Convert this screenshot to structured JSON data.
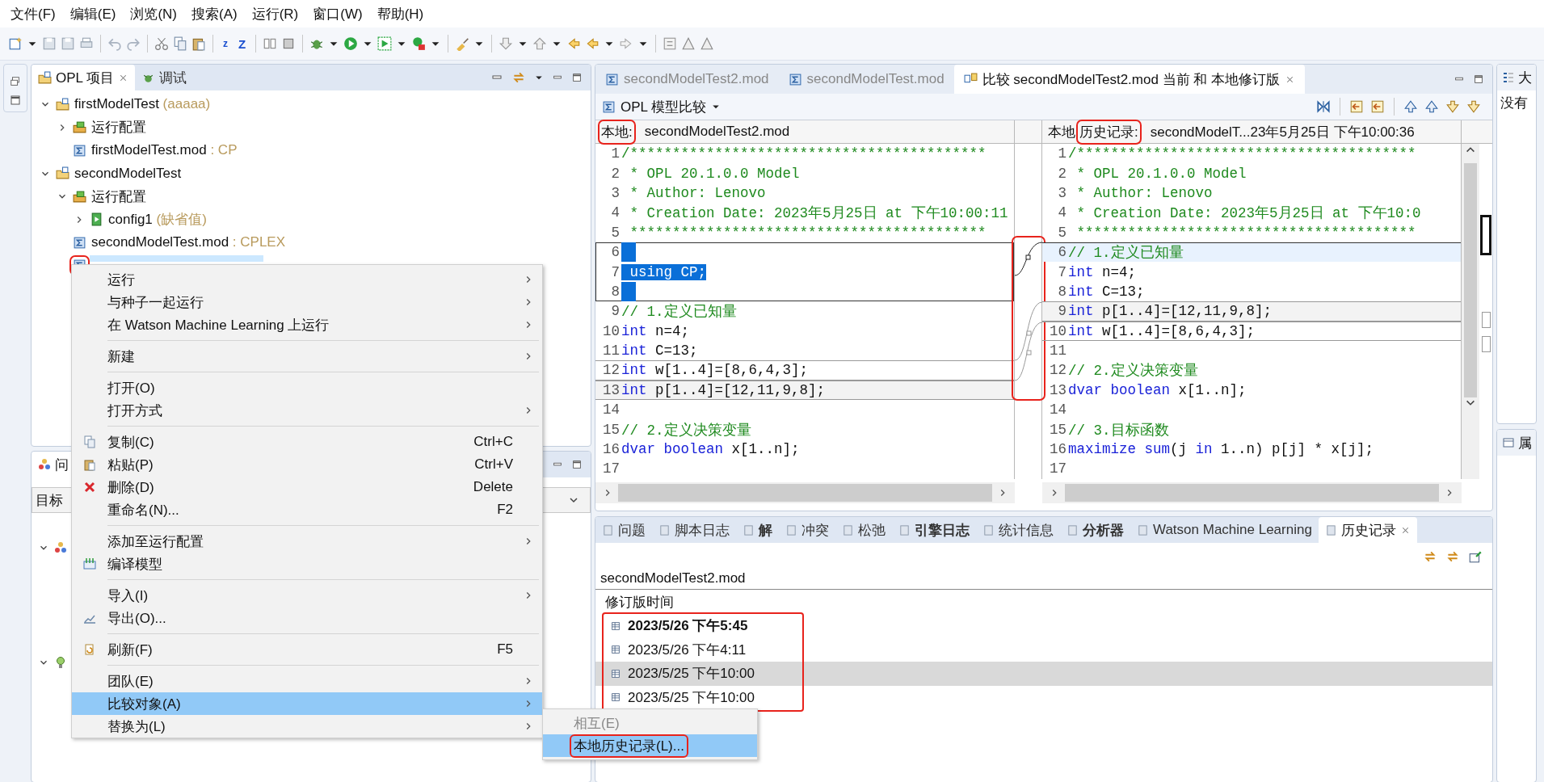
{
  "menu_bar": [
    "文件(F)",
    "编辑(E)",
    "浏览(N)",
    "搜索(A)",
    "运行(R)",
    "窗口(W)",
    "帮助(H)"
  ],
  "toolbar": {
    "letters": [
      "z",
      "Z"
    ]
  },
  "project_view": {
    "tabs": [
      {
        "label": "OPL 项目",
        "selected": true
      },
      {
        "label": "调试",
        "selected": false
      }
    ],
    "tree": [
      {
        "label": "firstModelTest",
        "suffix": "(aaaaa)",
        "kind": "project",
        "expanded": true,
        "selected": false,
        "children": [
          {
            "label": "运行配置",
            "kind": "runconfig",
            "expanded": false,
            "selected": false
          },
          {
            "label": "firstModelTest.mod",
            "suffix": ": CP",
            "kind": "model",
            "selected": false
          }
        ]
      },
      {
        "label": "secondModelTest",
        "kind": "project",
        "expanded": true,
        "selected": false,
        "children": [
          {
            "label": "运行配置",
            "kind": "runconfig",
            "expanded": true,
            "selected": false,
            "children": [
              {
                "label": "config1",
                "suffix": "(缺省值)",
                "kind": "config",
                "expanded": false,
                "selected": false
              }
            ]
          },
          {
            "label": "secondModelTest.mod",
            "suffix": ": CPLEX",
            "kind": "model",
            "selected": false
          },
          {
            "kind": "model",
            "selected": true,
            "highlighted": true
          }
        ]
      }
    ]
  },
  "problems_view": {
    "tab": "问",
    "filter": "目标",
    "groups": [
      {
        "kind": "targets",
        "expanded": true
      },
      {
        "kind": "hint",
        "expanded": true
      }
    ]
  },
  "context_menu": {
    "items": [
      {
        "kind": "item",
        "label": "运行",
        "submenu": true,
        "selected": false
      },
      {
        "kind": "item",
        "label": "与种子一起运行",
        "submenu": true,
        "selected": false
      },
      {
        "kind": "item",
        "label": "在 Watson Machine Learning 上运行",
        "submenu": true,
        "selected": false
      },
      {
        "kind": "separator"
      },
      {
        "kind": "item",
        "label": "新建",
        "submenu": true,
        "selected": false
      },
      {
        "kind": "separator"
      },
      {
        "kind": "item",
        "label": "打开(O)",
        "submenu": false,
        "selected": false
      },
      {
        "kind": "item",
        "label": "打开方式",
        "submenu": true,
        "selected": false
      },
      {
        "kind": "separator"
      },
      {
        "kind": "item",
        "label": "复制(C)",
        "shortcut": "Ctrl+C",
        "submenu": false,
        "selected": false
      },
      {
        "kind": "item",
        "label": "粘贴(P)",
        "shortcut": "Ctrl+V",
        "submenu": false,
        "selected": false
      },
      {
        "kind": "item",
        "label": "删除(D)",
        "shortcut": "Delete",
        "submenu": false,
        "selected": false
      },
      {
        "kind": "item",
        "label": "重命名(N)...",
        "shortcut": "F2",
        "submenu": false,
        "selected": false
      },
      {
        "kind": "separator"
      },
      {
        "kind": "item",
        "label": "添加至运行配置",
        "submenu": true,
        "selected": false
      },
      {
        "kind": "item",
        "label": "编译模型",
        "submenu": false,
        "selected": false
      },
      {
        "kind": "separator"
      },
      {
        "kind": "item",
        "label": "导入(I)",
        "submenu": true,
        "selected": false
      },
      {
        "kind": "item",
        "label": "导出(O)...",
        "submenu": false,
        "selected": false
      },
      {
        "kind": "separator"
      },
      {
        "kind": "item",
        "label": "刷新(F)",
        "shortcut": "F5",
        "submenu": false,
        "selected": false
      },
      {
        "kind": "separator"
      },
      {
        "kind": "item",
        "label": "团队(E)",
        "submenu": true,
        "selected": false
      },
      {
        "kind": "item",
        "label": "比较对象(A)",
        "submenu": true,
        "selected": true
      },
      {
        "kind": "item",
        "label": "替换为(L)",
        "submenu": true,
        "selected": false
      }
    ],
    "submenu": [
      {
        "label": "相互(E)",
        "disabled": true,
        "selected": false,
        "highlighted": false
      },
      {
        "label": "本地历史记录(L)...",
        "disabled": false,
        "selected": true,
        "highlighted": true
      }
    ]
  },
  "editor": {
    "tabs": [
      {
        "label": "secondModelTest2.mod",
        "kind": "model",
        "selected": false
      },
      {
        "label": "secondModelTest.mod",
        "kind": "model",
        "selected": false
      },
      {
        "label": "比较 secondModelTest2.mod 当前 和 本地修订版",
        "kind": "compare",
        "selected": true
      }
    ],
    "compare": {
      "title": "OPL 模型比较",
      "left_header": {
        "parts": [
          {
            "text": "本地:",
            "highlighted": true
          }
        ],
        "file": "secondModelTest2.mod"
      },
      "right_header": {
        "parts": [
          {
            "text": "本地",
            "highlighted": false
          },
          {
            "text": "历史记录:",
            "highlighted": true
          }
        ],
        "file": "secondModelT...23年5月25日 下午10:00:36"
      },
      "gutter_highlighted": true,
      "left_lines": [
        {
          "n": "1",
          "kind": "plain",
          "tokens": [
            {
              "kind": "comment",
              "text": "/******************************************"
            }
          ]
        },
        {
          "n": "2",
          "kind": "plain",
          "tokens": [
            {
              "kind": "comment",
              "text": " * OPL 20.1.0.0 Model"
            }
          ]
        },
        {
          "n": "3",
          "kind": "plain",
          "tokens": [
            {
              "kind": "comment",
              "text": " * Author: Lenovo"
            }
          ]
        },
        {
          "n": "4",
          "kind": "plain",
          "tokens": [
            {
              "kind": "comment",
              "text": " * Creation Date: 2023年5月25日 at 下午10:00:11"
            }
          ]
        },
        {
          "n": "5",
          "kind": "plain",
          "tokens": [
            {
              "kind": "comment",
              "text": " ******************************************"
            }
          ]
        },
        {
          "n": "6",
          "kind": "selected"
        },
        {
          "n": "7",
          "kind": "selected",
          "tokens": [
            {
              "kind": "plain",
              "text": " using CP;"
            }
          ]
        },
        {
          "n": "8",
          "kind": "selected"
        },
        {
          "n": "9",
          "kind": "plain",
          "tokens": [
            {
              "kind": "comment",
              "text": "// 1.定义已知量"
            }
          ]
        },
        {
          "n": "10",
          "kind": "plain",
          "tokens": [
            {
              "kind": "keyword",
              "text": "int"
            },
            {
              "kind": "plain",
              "text": " n=4;"
            }
          ]
        },
        {
          "n": "11",
          "kind": "plain",
          "tokens": [
            {
              "kind": "keyword",
              "text": "int"
            },
            {
              "kind": "plain",
              "text": " C=13;"
            }
          ]
        },
        {
          "n": "12",
          "kind": "changed",
          "tokens": [
            {
              "kind": "keyword",
              "text": "int"
            },
            {
              "kind": "plain",
              "text": " w[1..4]=[8,6,4,3];"
            }
          ]
        },
        {
          "n": "13",
          "kind": "shaded",
          "tokens": [
            {
              "kind": "keyword",
              "text": "int"
            },
            {
              "kind": "plain",
              "text": " p[1..4]=[12,11,9,8];"
            }
          ]
        },
        {
          "n": "14",
          "kind": "plain"
        },
        {
          "n": "15",
          "kind": "plain",
          "tokens": [
            {
              "kind": "comment",
              "text": "// 2.定义决策变量"
            }
          ]
        },
        {
          "n": "16",
          "kind": "plain",
          "tokens": [
            {
              "kind": "keyword",
              "text": "dvar boolean"
            },
            {
              "kind": "plain",
              "text": " x[1..n];"
            }
          ]
        },
        {
          "n": "17",
          "kind": "plain"
        }
      ],
      "right_lines": [
        {
          "n": "1",
          "kind": "plain",
          "tokens": [
            {
              "kind": "comment",
              "text": "/****************************************"
            }
          ]
        },
        {
          "n": "2",
          "kind": "plain",
          "tokens": [
            {
              "kind": "comment",
              "text": " * OPL 20.1.0.0 Model"
            }
          ]
        },
        {
          "n": "3",
          "kind": "plain",
          "tokens": [
            {
              "kind": "comment",
              "text": " * Author: Lenovo"
            }
          ]
        },
        {
          "n": "4",
          "kind": "plain",
          "tokens": [
            {
              "kind": "comment",
              "text": " * Creation Date: 2023年5月25日 at 下午10:0"
            }
          ]
        },
        {
          "n": "5",
          "kind": "plain",
          "tokens": [
            {
              "kind": "comment",
              "text": " ****************************************"
            }
          ]
        },
        {
          "n": "6",
          "kind": "current",
          "tokens": [
            {
              "kind": "comment",
              "text": "// 1.定义已知量"
            }
          ]
        },
        {
          "n": "7",
          "kind": "plain",
          "tokens": [
            {
              "kind": "keyword",
              "text": "int"
            },
            {
              "kind": "plain",
              "text": " n=4;"
            }
          ]
        },
        {
          "n": "8",
          "kind": "plain",
          "tokens": [
            {
              "kind": "keyword",
              "text": "int"
            },
            {
              "kind": "plain",
              "text": " C=13;"
            }
          ]
        },
        {
          "n": "9",
          "kind": "shaded",
          "tokens": [
            {
              "kind": "keyword",
              "text": "int"
            },
            {
              "kind": "plain",
              "text": " p[1..4]=[12,11,9,8];"
            }
          ]
        },
        {
          "n": "10",
          "kind": "changed",
          "tokens": [
            {
              "kind": "keyword",
              "text": "int"
            },
            {
              "kind": "plain",
              "text": " w[1..4]=[8,6,4,3];"
            }
          ]
        },
        {
          "n": "11",
          "kind": "plain"
        },
        {
          "n": "12",
          "kind": "plain",
          "tokens": [
            {
              "kind": "comment",
              "text": "// 2.定义决策变量"
            }
          ]
        },
        {
          "n": "13",
          "kind": "plain",
          "tokens": [
            {
              "kind": "keyword",
              "text": "dvar boolean"
            },
            {
              "kind": "plain",
              "text": " x[1..n];"
            }
          ]
        },
        {
          "n": "14",
          "kind": "plain"
        },
        {
          "n": "15",
          "kind": "plain",
          "tokens": [
            {
              "kind": "comment",
              "text": "// 3.目标函数"
            }
          ]
        },
        {
          "n": "16",
          "kind": "plain",
          "tokens": [
            {
              "kind": "keyword",
              "text": "maximize sum"
            },
            {
              "kind": "plain",
              "text": "(j "
            },
            {
              "kind": "keyword",
              "text": "in"
            },
            {
              "kind": "plain",
              "text": " 1..n) p[j] * x[j];"
            }
          ]
        },
        {
          "n": "17",
          "kind": "plain"
        }
      ]
    }
  },
  "outline_view": {
    "tab": "大",
    "message": "没有"
  },
  "properties_view": {
    "tab": "属"
  },
  "bottom_panel": {
    "tabs": [
      {
        "label": "问题",
        "bold": false,
        "selected": false
      },
      {
        "label": "脚本日志",
        "bold": false,
        "selected": false
      },
      {
        "label": "解",
        "bold": true,
        "selected": false
      },
      {
        "label": "冲突",
        "bold": false,
        "selected": false
      },
      {
        "label": "松弛",
        "bold": false,
        "selected": false
      },
      {
        "label": "引擎日志",
        "bold": true,
        "selected": false
      },
      {
        "label": "统计信息",
        "bold": false,
        "selected": false
      },
      {
        "label": "分析器",
        "bold": true,
        "selected": false
      },
      {
        "label": "Watson Machine Learning",
        "bold": false,
        "selected": false
      },
      {
        "label": "历史记录",
        "bold": false,
        "selected": true
      }
    ],
    "history": {
      "file": "secondModelTest2.mod",
      "column": "修订版时间",
      "highlighted": true,
      "rows": [
        {
          "time": "2023/5/26 下午5:45",
          "current": true,
          "selected": false
        },
        {
          "time": "2023/5/26 下午4:11",
          "current": false,
          "selected": false
        },
        {
          "time": "2023/5/25 下午10:00",
          "current": false,
          "selected": true
        },
        {
          "time": "2023/5/25 下午10:00",
          "current": false,
          "selected": false
        }
      ]
    }
  }
}
